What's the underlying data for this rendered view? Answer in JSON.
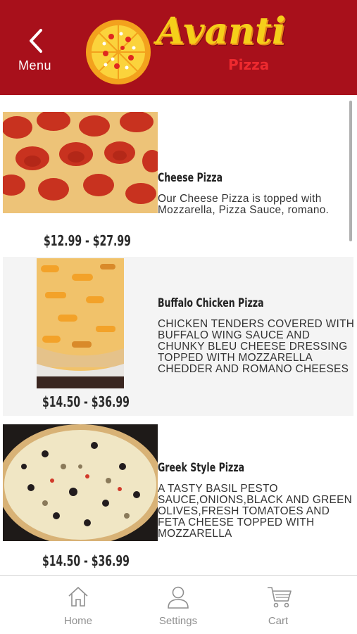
{
  "header": {
    "back_label": "Menu",
    "logo_text": "Avanti",
    "logo_subtext": "Pizza",
    "brand_color": "#a8101b"
  },
  "items": [
    {
      "title": "Cheese Pizza",
      "description": "Our Cheese Pizza is topped with Mozzarella, Pizza Sauce, romano.",
      "price": "$12.99 - $27.99"
    },
    {
      "title": "Buffalo Chicken Pizza",
      "description": "CHICKEN TENDERS COVERED WITH BUFFALO WING SAUCE AND CHUNKY BLEU CHEESE DRESSING TOPPED WITH MOZZARELLA CHEDDER AND ROMANO CHEESES",
      "price": "$14.50 - $36.99"
    },
    {
      "title": "Greek Style Pizza",
      "description": "A TASTY BASIL PESTO SAUCE,ONIONS,BLACK AND GREEN OLIVES,FRESH TOMATOES AND FETA CHEESE TOPPED WITH MOZZARELLA",
      "price": "$14.50 - $36.99"
    }
  ],
  "tabs": [
    {
      "label": "Home",
      "icon": "home-icon"
    },
    {
      "label": "Settings",
      "icon": "user-icon"
    },
    {
      "label": "Cart",
      "icon": "cart-icon"
    }
  ]
}
